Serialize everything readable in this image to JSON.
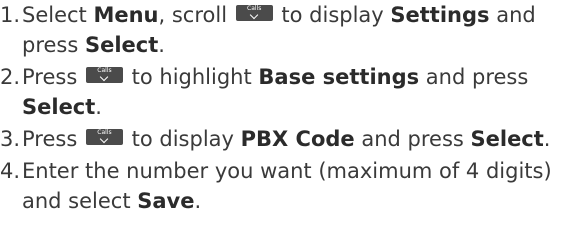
{
  "steps": [
    {
      "number": "1.",
      "lines": [
        [
          {
            "t": "Select "
          },
          {
            "t": "Menu",
            "b": true
          },
          {
            "t": ", scroll "
          },
          {
            "icon": "calls-scroll-down-key",
            "label": "Calls"
          },
          {
            "t": " to display "
          },
          {
            "t": "Settings",
            "b": true
          },
          {
            "t": " and"
          }
        ],
        [
          {
            "t": "press "
          },
          {
            "t": "Select",
            "b": true
          },
          {
            "t": "."
          }
        ]
      ]
    },
    {
      "number": "2.",
      "lines": [
        [
          {
            "t": "Press "
          },
          {
            "icon": "calls-scroll-down-key",
            "label": "Calls"
          },
          {
            "t": " to highlight "
          },
          {
            "t": "Base settings",
            "b": true
          },
          {
            "t": " and press"
          }
        ],
        [
          {
            "t": "Select",
            "b": true
          },
          {
            "t": "."
          }
        ]
      ]
    },
    {
      "number": "3.",
      "lines": [
        [
          {
            "t": "Press "
          },
          {
            "icon": "calls-scroll-down-key",
            "label": "Calls"
          },
          {
            "t": " to display "
          },
          {
            "t": "PBX Code",
            "b": true
          },
          {
            "t": " and press "
          },
          {
            "t": "Select",
            "b": true
          },
          {
            "t": "."
          }
        ]
      ]
    },
    {
      "number": "4.",
      "lines": [
        [
          {
            "t": "Enter the number you want (maximum of 4 digits)"
          }
        ],
        [
          {
            "t": "and select "
          },
          {
            "t": "Save",
            "b": true
          },
          {
            "t": "."
          }
        ]
      ]
    }
  ]
}
